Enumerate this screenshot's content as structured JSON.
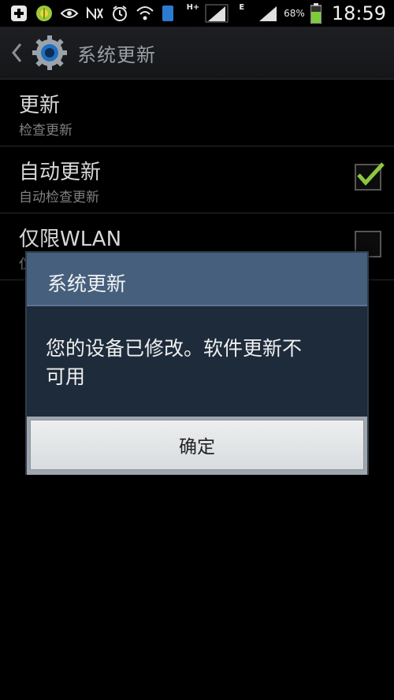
{
  "status_bar": {
    "network_type": "H+",
    "network_type_2": "E",
    "sim_badge": "1",
    "battery": "68%",
    "time": "18:59",
    "battery_color": "#7ecb3a"
  },
  "action_bar": {
    "title": "系统更新"
  },
  "settings": [
    {
      "title": "更新",
      "subtitle": "检查更新",
      "has_checkbox": false
    },
    {
      "title": "自动更新",
      "subtitle": "自动检查更新",
      "has_checkbox": true,
      "checked": true
    },
    {
      "title": "仅限WLAN",
      "subtitle": "仅",
      "has_checkbox": true,
      "checked": false
    }
  ],
  "dialog": {
    "title": "系统更新",
    "message_line1": "您的设备已修改。软件更新不",
    "message_line2": "可用",
    "ok_label": "确定"
  },
  "colors": {
    "dialog_title_bg": "#455f7d",
    "dialog_body_bg": "#1e2b3a",
    "checkmark": "#8ec63f"
  }
}
